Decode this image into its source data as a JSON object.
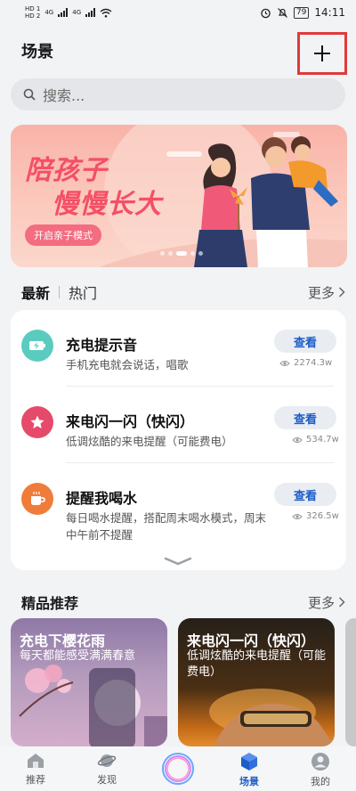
{
  "status_bar": {
    "sim1": "HD 1",
    "sim2": "HD 2",
    "net1": "4G",
    "net2": "4G",
    "battery": "79",
    "time": "14:11"
  },
  "header": {
    "title": "场景",
    "add_label": "+"
  },
  "search": {
    "placeholder": "搜索..."
  },
  "banner": {
    "title_line1": "陪孩子",
    "title_line2": "慢慢长大",
    "cta": "开启亲子模式"
  },
  "tabs": {
    "latest": "最新",
    "hot": "热门",
    "more": "更多"
  },
  "scenes": [
    {
      "title": "充电提示音",
      "desc": "手机充电就会说话，唱歌",
      "button": "查看",
      "views": "2274.3w",
      "color": "#5ccbbf",
      "icon": "battery-charge-icon"
    },
    {
      "title": "来电闪一闪（快闪）",
      "desc": "低调炫酷的来电提醒（可能费电）",
      "button": "查看",
      "views": "534.7w",
      "color": "#e64a6a",
      "icon": "star-icon"
    },
    {
      "title": "提醒我喝水",
      "desc": "每日喝水提醒，搭配周末喝水模式，周末中午前不提醒",
      "button": "查看",
      "views": "326.5w",
      "color": "#f07c3a",
      "icon": "cup-icon"
    }
  ],
  "featured": {
    "title": "精品推荐",
    "more": "更多",
    "cards": [
      {
        "title": "充电下樱花雨",
        "subtitle": "每天都能感受满满春意"
      },
      {
        "title": "来电闪一闪（快闪）",
        "subtitle": "低调炫酷的来电提醒（可能费电）"
      }
    ]
  },
  "bottom_nav": [
    {
      "label": "推荐",
      "icon": "home-icon"
    },
    {
      "label": "发现",
      "icon": "planet-icon"
    },
    {
      "label": "",
      "icon": "assistant-orb-icon"
    },
    {
      "label": "场景",
      "icon": "cube-icon"
    },
    {
      "label": "我的",
      "icon": "person-icon"
    }
  ]
}
